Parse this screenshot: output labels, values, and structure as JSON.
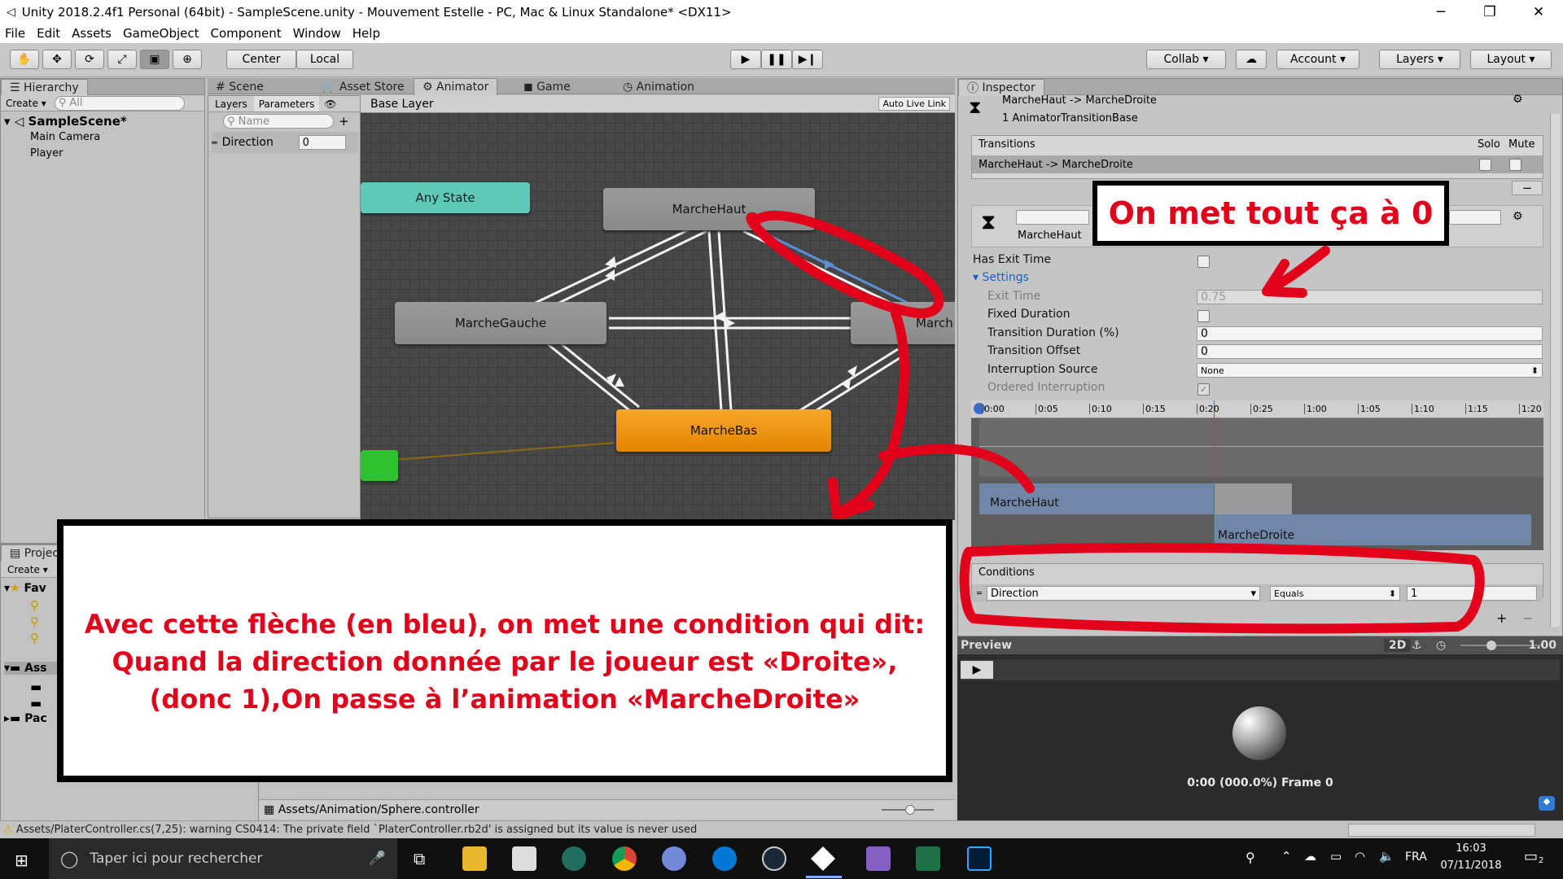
{
  "window": {
    "title": "Unity 2018.2.4f1 Personal (64bit) - SampleScene.unity - Mouvement Estelle - PC, Mac & Linux Standalone* <DX11>"
  },
  "menu": [
    "File",
    "Edit",
    "Assets",
    "GameObject",
    "Component",
    "Window",
    "Help"
  ],
  "toolbar": {
    "center": "Center",
    "local": "Local",
    "collab": "Collab",
    "account": "Account",
    "layers": "Layers",
    "layout": "Layout"
  },
  "hierarchy": {
    "tab": "Hierarchy",
    "create": "Create",
    "search_placeholder": "All",
    "scene": "SampleScene*",
    "items": [
      "Main Camera",
      "Player"
    ]
  },
  "center_tabs": [
    "Scene",
    "Asset Store",
    "Animator",
    "Game",
    "Animation"
  ],
  "animator": {
    "layers_tab": "Layers",
    "parameters_tab": "Parameters",
    "name_placeholder": "Name",
    "param_name": "Direction",
    "param_value": "0",
    "base_layer": "Base Layer",
    "auto_live_link": "Auto Live Link",
    "states": {
      "any": "Any State",
      "haut": "MarcheHaut",
      "gauche": "MarcheGauche",
      "droite": "March",
      "bas": "MarcheBas"
    },
    "path": "Assets/Animation/Sphere.controller"
  },
  "project": {
    "tab": "Projec",
    "create": "Create",
    "fav": "Fav",
    "assets": "Ass",
    "packages": "Pac"
  },
  "inspector": {
    "tab": "Inspector",
    "title": "MarcheHaut -> MarcheDroite",
    "subtitle": "1 AnimatorTransitionBase",
    "transitions_header": "Transitions",
    "solo": "Solo",
    "mute": "Mute",
    "transition_item": "MarcheHaut -> MarcheDroite",
    "preview_state": "MarcheHaut",
    "has_exit_time": "Has Exit Time",
    "settings": "Settings",
    "exit_time": "Exit Time",
    "exit_time_value": "0.75",
    "fixed_duration": "Fixed Duration",
    "transition_duration": "Transition Duration (%)",
    "transition_duration_value": "0",
    "transition_offset": "Transition Offset",
    "transition_offset_value": "0",
    "interruption_source": "Interruption Source",
    "interruption_source_value": "None",
    "ordered_interruption": "Ordered Interruption",
    "timeline_ticks": [
      "0:00",
      "0:05",
      "0:10",
      "0:15",
      "0:20",
      "0:25",
      "1:00",
      "1:05",
      "1:10",
      "1:15",
      "1:20"
    ],
    "track_from": "MarcheHaut",
    "track_to": "MarcheDroite",
    "conditions_header": "Conditions",
    "cond_param": "Direction",
    "cond_op": "Equals",
    "cond_value": "1",
    "preview_label": "Preview",
    "preview_2d": "2D",
    "preview_speed": "1.00",
    "preview_time": "0:00 (000.0%) Frame 0"
  },
  "status": {
    "warning": "Assets/PlaterController.cs(7,25): warning CS0414: The private field `PlaterController.rb2d' is assigned but its value is never used"
  },
  "annotations": {
    "top": "On met tout ça à 0",
    "bottom": [
      "Avec cette flèche (en bleu), on met une condition qui dit:",
      "Quand la direction donnée par le joueur est «Droite»,",
      "(donc 1),On passe à l’animation «MarcheDroite»"
    ]
  },
  "taskbar": {
    "search": "Taper ici pour rechercher",
    "lang": "FRA",
    "time": "16:03",
    "date": "07/11/2018",
    "notif": "2"
  },
  "colors": {
    "annotation_red": "#e3001a",
    "selected_arrow": "#5b8fd8",
    "state_orange": "#f29a1c",
    "any_state": "#5fc9b7"
  }
}
